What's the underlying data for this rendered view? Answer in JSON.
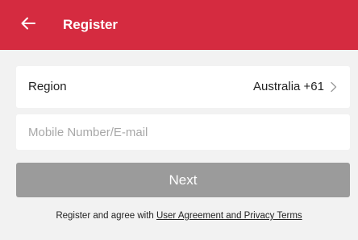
{
  "header": {
    "title": "Register",
    "background_color": "#d52b40",
    "back_icon": "arrow-left-icon"
  },
  "region": {
    "label": "Region",
    "value": "Australia +61",
    "chevron_icon": "chevron-right-icon"
  },
  "account_input": {
    "placeholder": "Mobile Number/E-mail",
    "value": ""
  },
  "next_button": {
    "label": "Next",
    "color": "#9b9b9b"
  },
  "agreement": {
    "prefix": "Register and agree with ",
    "link_text": "User Agreement and Privacy Terms"
  }
}
